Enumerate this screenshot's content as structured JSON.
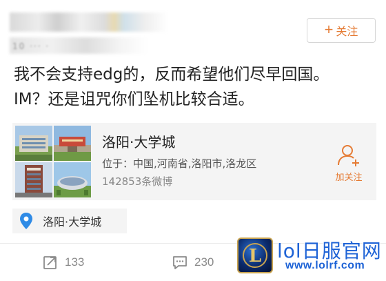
{
  "header": {
    "username_blurred": "·· ··· ·· ·",
    "meta_blurred": "10 ··· ·"
  },
  "follow_button": {
    "label": "关注",
    "plus": "+"
  },
  "post": {
    "text": "我不会支持edg的，反而希望他们尽早回国。IM？还是诅咒你们坠机比较合适。"
  },
  "place_card": {
    "name": "洛阳·大学城",
    "location": "位于：中国,河南省,洛阳市,洛龙区",
    "post_count": "142853条微博",
    "follow_label": "加关注",
    "thumbnails": [
      "campus-building-photo",
      "campus-gate-photo",
      "campus-tower-photo",
      "campus-stadium-photo"
    ]
  },
  "location_chip": {
    "label": "洛阳·大学城",
    "icon": "map-pin-icon"
  },
  "actions": {
    "repost_count": "133",
    "comment_count": "230"
  },
  "watermark": {
    "title": "lol日服官网",
    "url": "www.lolrf.com",
    "logo_letter": "L"
  },
  "colors": {
    "accent": "#e57b34",
    "card_bg": "#f4f4f4",
    "watermark_blue": "#1e63d6",
    "pin_blue": "#2f8be6"
  }
}
